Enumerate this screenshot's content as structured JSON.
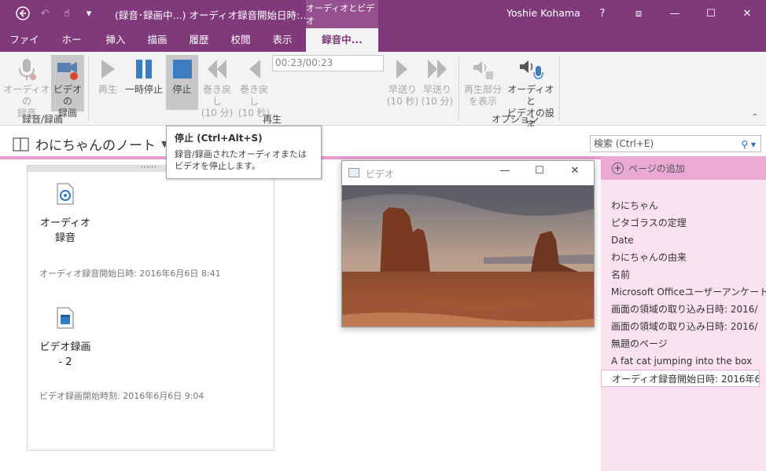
{
  "titlebar": {
    "window_title": "(録音･録画中...) オーディオ録音開始日時:…",
    "context_tab": "オーディオとビデオ",
    "user": "Yoshie Kohama",
    "help": "?",
    "qat_back": "←",
    "qat_undo": "↶",
    "qat_touch": "☝",
    "qat_more": "▾",
    "restore_ribbon": "⧈",
    "minimize": "—",
    "maximize": "☐",
    "close": "✕"
  },
  "tabs": [
    "ファイル",
    "ホーム",
    "挿入",
    "描画",
    "履歴",
    "校閲",
    "表示",
    "録音中..."
  ],
  "ribbon": {
    "audio_record": "オーディオの\n録音",
    "video_record": "ビデオの\n録画",
    "play": "再生",
    "pause": "一時停止",
    "stop": "停止",
    "rewind10m": "巻き戻し\n(10 分)",
    "rewind10s": "巻き戻し\n(10 秒)",
    "time": "00:23/00:23",
    "forward10s": "早送り\n(10 秒)",
    "forward10m": "早送り\n(10 分)",
    "see_playback": "再生部分\nを表示",
    "av_settings": "オーディオと\nビデオの設定",
    "group_record": "録音/録画",
    "group_play": "再生",
    "group_options": "オプション",
    "collapse": "⌃"
  },
  "notebook": {
    "name": "わにちゃんのノート",
    "search_placeholder": "検索 (Ctrl+E)",
    "search_icon": "🔍"
  },
  "tooltip": {
    "title": "停止 (Ctrl+Alt+S)",
    "body": "録音/録画されたオーディオまたはビデオを停止します。"
  },
  "note": {
    "audio_label_1": "オーディオ",
    "audio_label_2": "録音",
    "audio_stamp": "オーディオ録音開始日時: 2016年6月6日 8:41",
    "video_label_1": "ビデオ録画",
    "video_label_2": "- 2",
    "video_stamp": "ビデオ録画開始時刻: 2016年6月6日 9:04",
    "handle": "⋯⋯"
  },
  "video_window": {
    "title": "ビデオ",
    "minimize": "—",
    "maximize": "☐",
    "close": "✕"
  },
  "page_pane": {
    "add_page": "ページの追加",
    "add_icon": "+",
    "pages": [
      "わにちゃん",
      "ピタゴラスの定理",
      "Date",
      "わにちゃんの由来",
      "名前",
      "Microsoft Officeユーザーアンケート",
      "画面の領域の取り込み日時: 2016/",
      "画面の領域の取り込み日時: 2016/",
      "無題のページ",
      "A fat cat jumping into the box",
      "オーディオ録音開始日時: 2016年6"
    ],
    "active_index": 10
  },
  "colors": {
    "brand": "#80397b",
    "accent_pink": "#e89ad0",
    "page_pane": "#f9e1f0",
    "stop_blue": "#3e7cc1"
  }
}
